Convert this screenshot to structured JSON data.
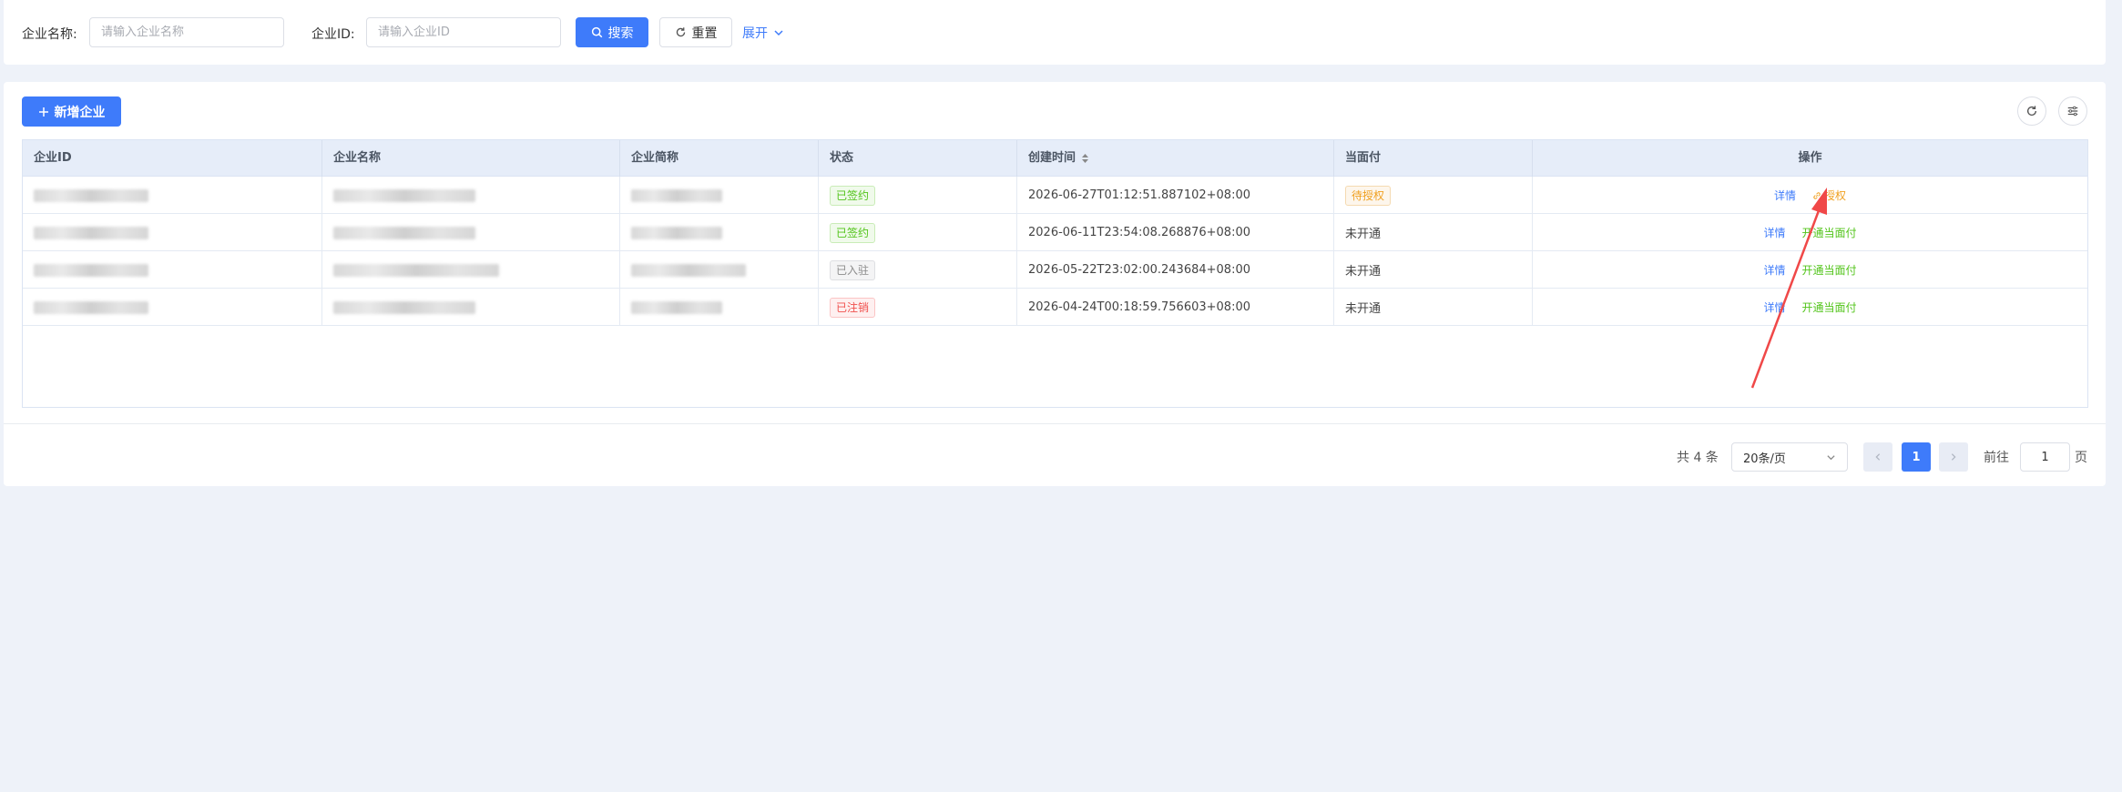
{
  "search": {
    "name_label": "企业名称:",
    "name_placeholder": "请输入企业名称",
    "id_label": "企业ID:",
    "id_placeholder": "请输入企业ID",
    "search_label": "搜索",
    "reset_label": "重置",
    "expand_label": "展开"
  },
  "toolbar": {
    "add_label": "新增企业"
  },
  "table": {
    "headers": {
      "id": "企业ID",
      "name": "企业名称",
      "short_name": "企业简称",
      "status": "状态",
      "created": "创建时间",
      "face_pay": "当面付",
      "actions": "操作"
    },
    "rows": [
      {
        "status": "已签约",
        "created": "2026-06-27T01:12:51.887102+08:00",
        "face_pay": "待授权",
        "action_detail": "详情",
        "action_other": "授权"
      },
      {
        "status": "已签约",
        "created": "2026-06-11T23:54:08.268876+08:00",
        "face_pay": "未开通",
        "action_detail": "详情",
        "action_other": "开通当面付"
      },
      {
        "status": "已入驻",
        "created": "2026-05-22T23:02:00.243684+08:00",
        "face_pay": "未开通",
        "action_detail": "详情",
        "action_other": "开通当面付"
      },
      {
        "status": "已注销",
        "created": "2026-04-24T00:18:59.756603+08:00",
        "face_pay": "未开通",
        "action_detail": "详情",
        "action_other": "开通当面付"
      }
    ]
  },
  "pagination": {
    "total": "共 4 条",
    "page_size": "20条/页",
    "current_page": "1",
    "goto_label": "前往",
    "goto_value": "1",
    "page_suffix": "页"
  },
  "colors": {
    "primary": "#3e7bfa",
    "success": "#52c41a",
    "warning": "#f0a020",
    "danger": "#f0504d",
    "annotation_arrow": "#f04848"
  },
  "icons": [
    "search-icon",
    "refresh-icon",
    "chevron-down-icon",
    "plus-icon",
    "column-settings-icon",
    "sort-icon",
    "link-icon",
    "chevron-left-icon",
    "chevron-right-icon"
  ]
}
